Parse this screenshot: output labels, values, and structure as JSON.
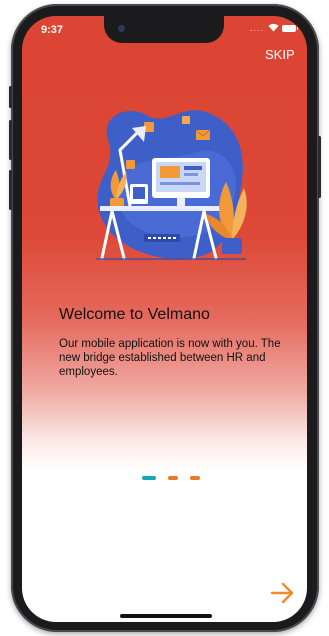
{
  "status_bar": {
    "time": "9:37",
    "signal": "....",
    "icons": [
      "wifi-icon",
      "battery-icon"
    ]
  },
  "header": {
    "skip_label": "SKIP"
  },
  "onboarding": {
    "illustration": "desk-workspace-illustration",
    "title": "Welcome to Velmano",
    "description": "Our mobile application is now with you. The new bridge established between HR and employees."
  },
  "pager": {
    "total_pages": 3,
    "active_index": 0,
    "active_color": "#17a7b3",
    "inactive_color": "#e87a2e"
  },
  "footer": {
    "next_icon": "arrow-right-icon",
    "next_color": "#f08a2a"
  },
  "colors": {
    "brand_red": "#dc4433",
    "illustration_blue": "#3f5fc8",
    "illustration_orange": "#f29a3a"
  }
}
